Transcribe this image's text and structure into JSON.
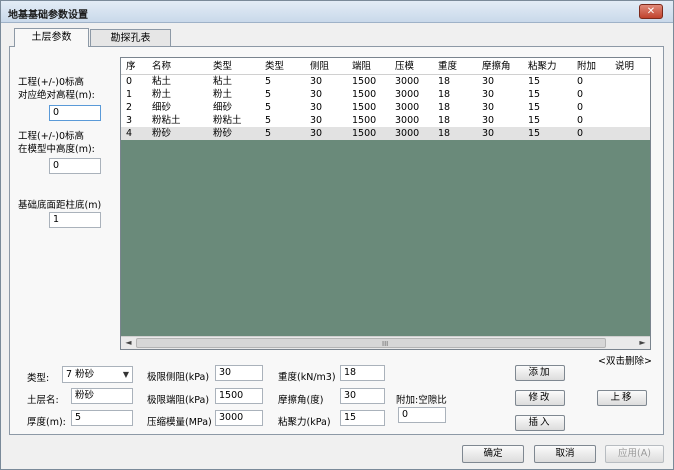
{
  "window": {
    "title": "地基基础参数设置",
    "close_glyph": "✕"
  },
  "tabs": [
    {
      "label": "土层参数",
      "active": true
    },
    {
      "label": "勘探孔表",
      "active": false
    }
  ],
  "left_panel": {
    "abs_elevation_label_1": "工程(+/-)0标高",
    "abs_elevation_label_2": "对应绝对高程(m):",
    "abs_elevation_value": "0",
    "model_height_label_1": "工程(+/-)0标高",
    "model_height_label_2": "在模型中高度(m):",
    "model_height_value": "0",
    "base_distance_label": "基础底面距柱底(m)",
    "base_distance_value": "1"
  },
  "grid": {
    "columns": [
      "序",
      "名称",
      "类型",
      "类型",
      "侧阻",
      "端阻",
      "压模",
      "重度",
      "摩擦角",
      "粘聚力",
      "附加",
      "说明"
    ],
    "rows": [
      [
        "0",
        "粘土",
        "粘土",
        "5",
        "30",
        "1500",
        "3000",
        "18",
        "30",
        "15",
        "0",
        ""
      ],
      [
        "1",
        "粉土",
        "粉土",
        "5",
        "30",
        "1500",
        "3000",
        "18",
        "30",
        "15",
        "0",
        ""
      ],
      [
        "2",
        "细砂",
        "细砂",
        "5",
        "30",
        "1500",
        "3000",
        "18",
        "30",
        "15",
        "0",
        ""
      ],
      [
        "3",
        "粉粘土",
        "粉粘土",
        "5",
        "30",
        "1500",
        "3000",
        "18",
        "30",
        "15",
        "0",
        ""
      ],
      [
        "4",
        "粉砂",
        "粉砂",
        "5",
        "30",
        "1500",
        "3000",
        "18",
        "30",
        "15",
        "0",
        ""
      ]
    ],
    "selected_row": 4,
    "scroll_left": "◄",
    "scroll_right": "►",
    "scroll_grip": "III"
  },
  "hint": "<双击删除>",
  "form": {
    "type_label": "类型:",
    "type_value": "7 粉砂",
    "name_label": "土层名:",
    "name_value": "粉砂",
    "thickness_label": "厚度(m):",
    "thickness_value": "5",
    "side_res_label": "极限侧阻(kPa)",
    "side_res_value": "30",
    "end_res_label": "极限端阻(kPa)",
    "end_res_value": "1500",
    "comp_mod_label": "压缩模量(MPa)",
    "comp_mod_value": "3000",
    "weight_label": "重度(kN/m3)",
    "weight_value": "18",
    "friction_label": "摩擦角(度)",
    "friction_value": "30",
    "cohesion_label": "粘聚力(kPa)",
    "cohesion_value": "15",
    "extra_label": "附加:空隙比",
    "extra_value": "0"
  },
  "buttons": {
    "add": "添加",
    "modify": "修改",
    "insert": "插入",
    "move_up": "上移",
    "ok": "确定",
    "cancel": "取消",
    "apply": "应用(A)"
  },
  "colors": {
    "grid_background": "#6a8a7a",
    "selected_row": "#e2e2e2"
  }
}
